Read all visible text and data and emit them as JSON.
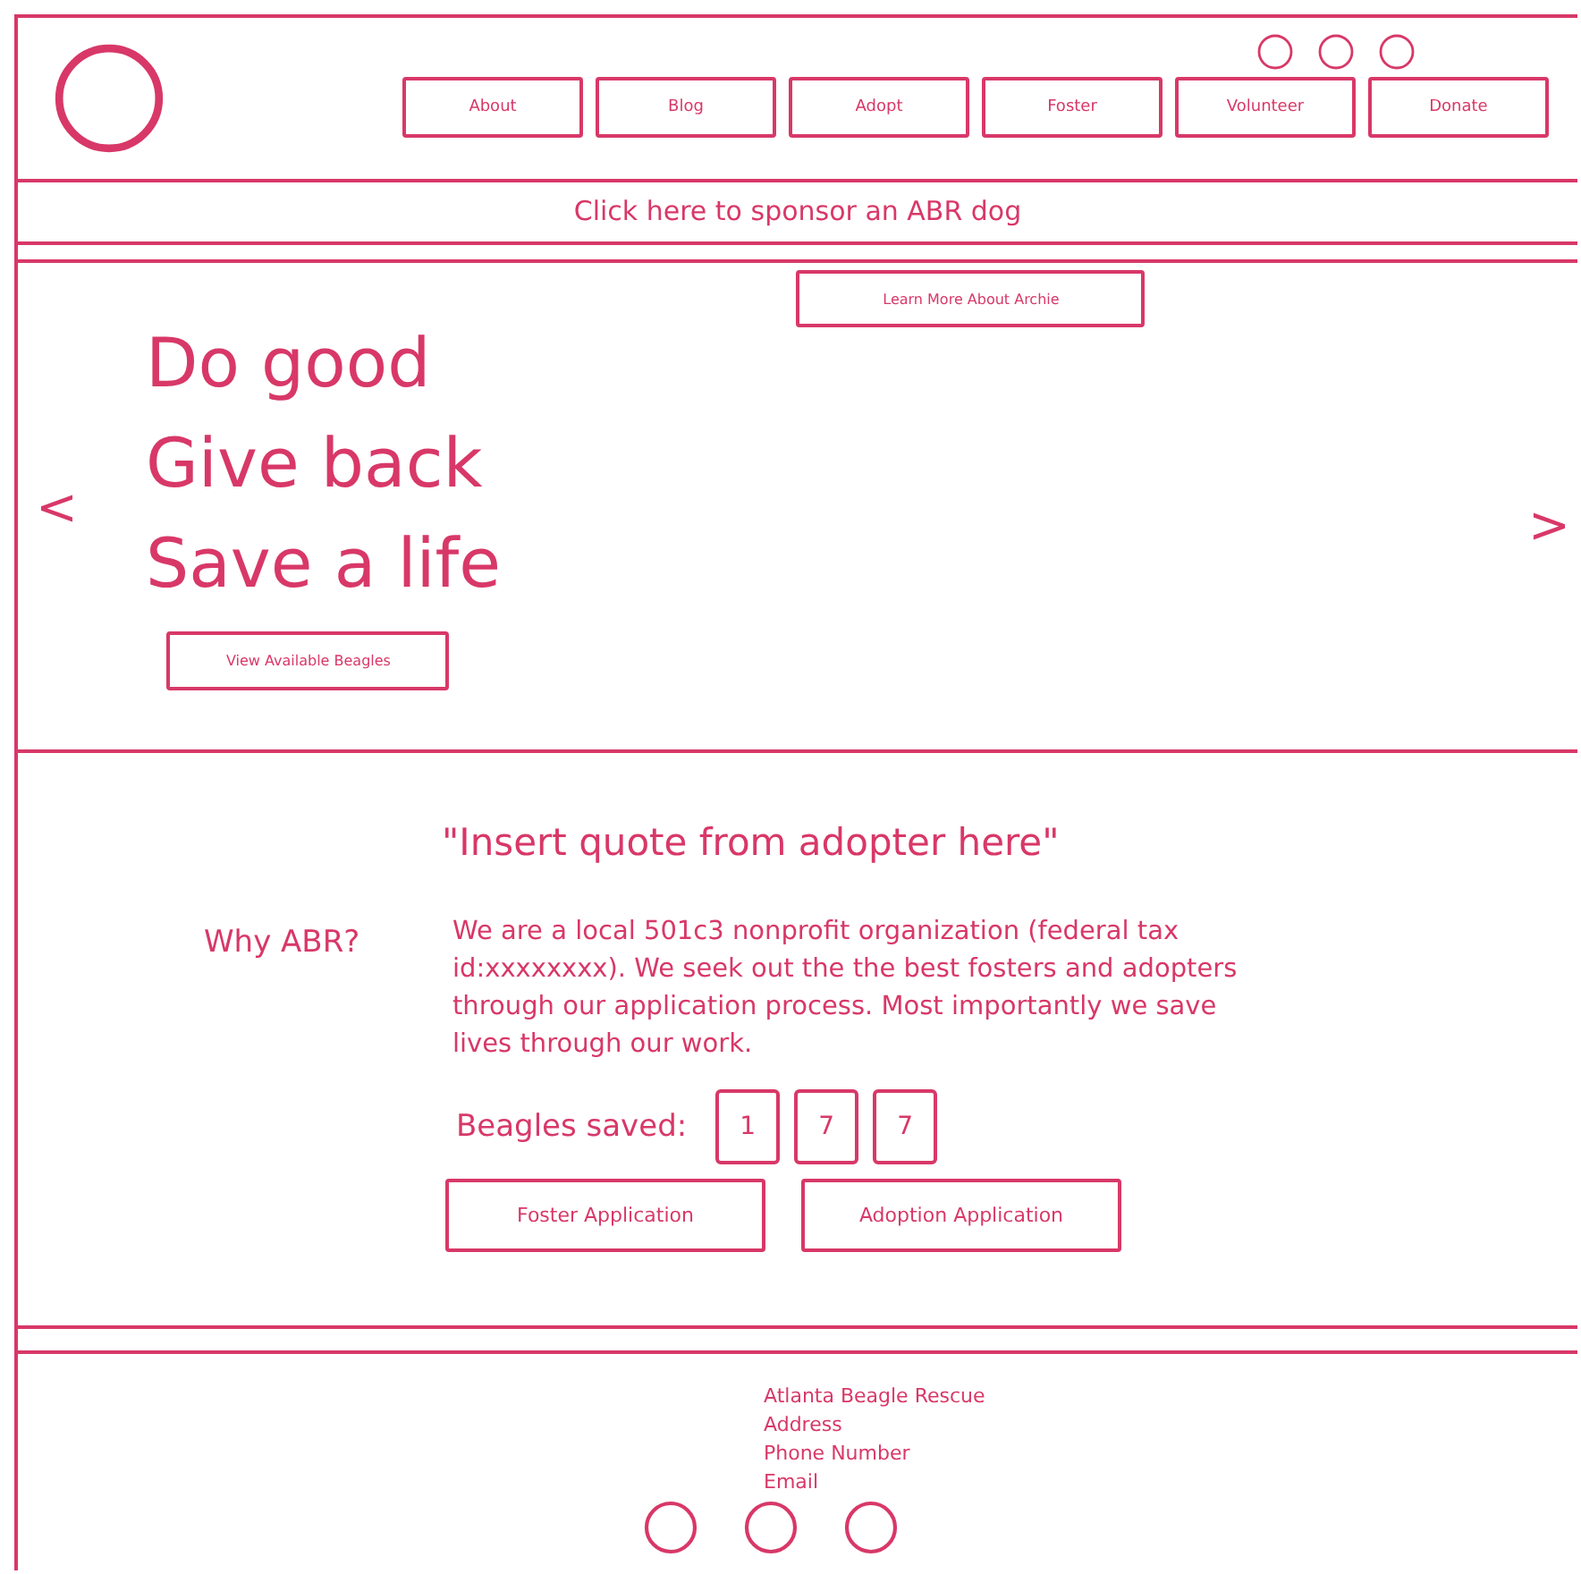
{
  "header": {
    "nav": [
      {
        "label": "About"
      },
      {
        "label": "Blog"
      },
      {
        "label": "Adopt"
      },
      {
        "label": "Foster"
      },
      {
        "label": "Volunteer"
      },
      {
        "label": "Donate"
      }
    ]
  },
  "banner": {
    "text": "Click here to sponsor an ABR dog"
  },
  "hero": {
    "button": "Learn More About Archie",
    "headline": [
      "Do good",
      "Give back",
      "Save a life"
    ],
    "cta": "View Available Beagles",
    "prev": "<",
    "next": ">"
  },
  "about": {
    "heading": "Why ABR?",
    "quote": "\"Insert quote from adopter here\"",
    "body": "We are a local 501c3 nonprofit organization (federal tax id:xxxxxxxx). We seek out the the best fosters and adopters through our application process. Most importantly we save lives through our work.",
    "counter_label": "Beagles saved:",
    "counter_digits": [
      "1",
      "7",
      "7"
    ],
    "buttons": [
      "Foster Application",
      "Adoption Application"
    ]
  },
  "footer": {
    "lines": [
      "Atlanta Beagle Rescue",
      "Address",
      "Phone Number",
      "Email"
    ]
  }
}
